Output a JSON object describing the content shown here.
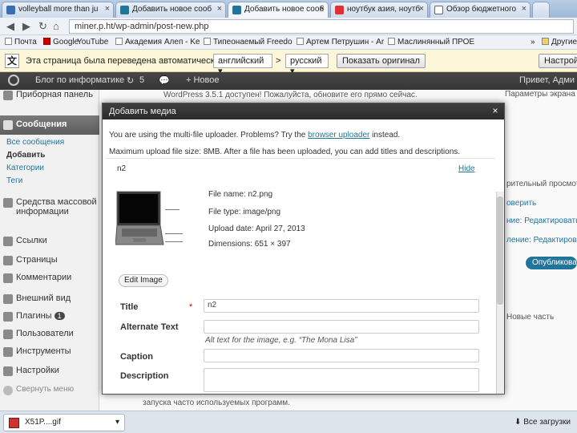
{
  "browser": {
    "tabs": [
      {
        "label": "volleyball more than ju",
        "active": false
      },
      {
        "label": "Добавить новое сооб",
        "active": false
      },
      {
        "label": "Добавить новое сооб",
        "active": true
      },
      {
        "label": "ноутбук азия, ноутб",
        "active": false
      },
      {
        "label": "Обзор бюджетного",
        "active": false
      }
    ],
    "url": "miner.p.ht/wp-admin/post-new.php",
    "bookmarks": [
      "Почта",
      "Google",
      "YouTube",
      "Академия Алeп - Ke",
      "Типеонаемый Freedo",
      "Артем Петрушин - Ar",
      "Маслинянный ПРОЕ"
    ],
    "bookmarks_more": "»",
    "bookmarks_other": "Другие"
  },
  "translate": {
    "message": "Эта страница была переведена автоматически",
    "from_lang": "английский",
    "arrow": ">",
    "to_lang": "русский",
    "show_original": "Показать оригинал",
    "settings": "Настройки"
  },
  "adminbar": {
    "site_name": "Блог по информатике",
    "updates": "5",
    "new": "+ Новое",
    "howdy": "Привет, Адми"
  },
  "sidebar": {
    "dashboard": "Приборная панель",
    "posts": "Сообщения",
    "sub_all": "Все сообщения",
    "sub_add": "Добавить",
    "sub_categories": "Категории",
    "sub_tags": "Теги",
    "media": "Средства массовой информации",
    "links": "Ссылки",
    "pages": "Страницы",
    "comments": "Комментарии",
    "appearance": "Внешний вид",
    "plugins": "Плагины",
    "plugins_badge": "1",
    "users": "Пользователи",
    "tools": "Инструменты",
    "settings": "Настройки",
    "collapse": "Свернуть меню"
  },
  "background": {
    "notice": "WordPress 3.5.1 доступен! Пожалуйста, обновите его прямо сейчас.",
    "right_1": "Параметры экрана",
    "right_2": "рительный просмотр",
    "right_3": "оверить",
    "right_4": "ние: Редактировать",
    "right_5": "ление: Редактировать",
    "right_6": "Опубликовать",
    "right_7": "Новые часть",
    "bottom": "запуска часто используемых программ."
  },
  "modal": {
    "title": "Добавить медиа",
    "close": "×",
    "intro_1": "You are using the multi-file uploader. Problems? Try the",
    "intro_link": "browser uploader",
    "intro_2": "instead.",
    "max_size": "Maximum upload file size: 8MB. After a file has been uploaded, you can add titles and descriptions.",
    "file_id": "n2",
    "hide": "Hide",
    "file_name": "File name: n2.png",
    "file_type": "File type: image/png",
    "upload_date": "Upload date: April 27, 2013",
    "dimensions": "Dimensions: 651 × 397",
    "edit_image": "Edit Image",
    "title_label": "Title",
    "required": "*",
    "title_value": "n2",
    "alt_label": "Alternate Text",
    "alt_value": "",
    "alt_help": "Alt text for the image, e.g. “The Mona Lisa”",
    "caption_label": "Caption",
    "caption_value": "",
    "description_label": "Description",
    "description_value": ""
  },
  "statusbar": {
    "download": "X51P....gif",
    "show_all": "Все загрузки"
  },
  "colors": {
    "link": "#21759b",
    "adminbar": "#464646",
    "translate_bg": "#fdf6d8",
    "modal_head": "#2b2b2b"
  }
}
